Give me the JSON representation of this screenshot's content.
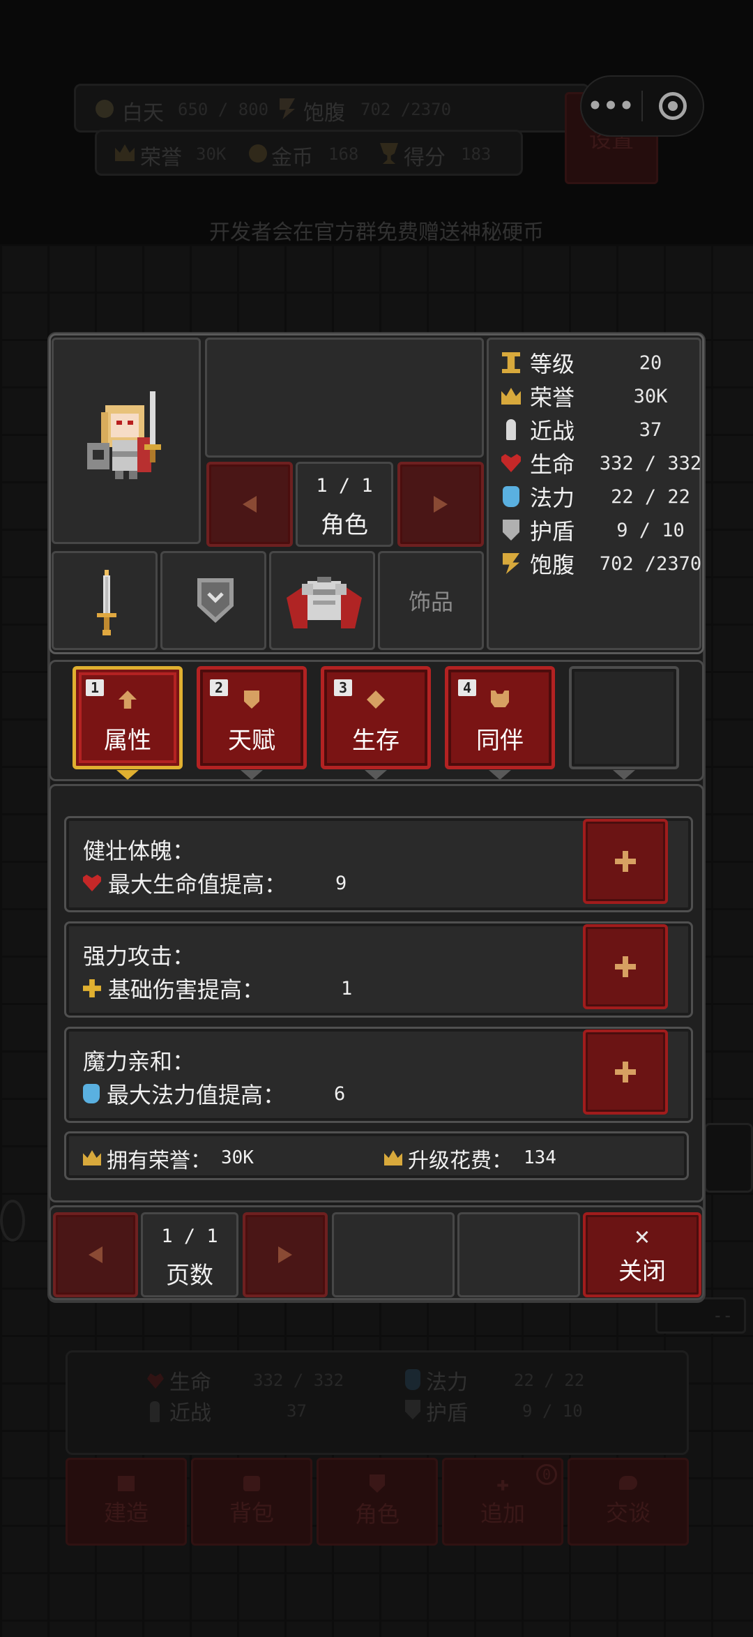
{
  "colors": {
    "accent_red": "#a11c1c",
    "tab_active_border": "#e0b030",
    "gold": "#d4a640",
    "background": "#141414"
  },
  "hud": {
    "day_label": "白天",
    "day_value": "650 / 800",
    "hunger_label": "饱腹",
    "hunger_value": "702 /2370",
    "honor_label": "荣誉",
    "honor_value": "30K",
    "gold_label": "金币",
    "gold_value": "168",
    "score_label": "得分",
    "score_value": "183",
    "settings_label": "设置",
    "notice": "开发者会在官方群免费赠送神秘硬币"
  },
  "capsule": {
    "more_icon": "more-dots-icon",
    "close_icon": "target-icon"
  },
  "character": {
    "page": "1 / 1",
    "tab_label": "角色",
    "slots": {
      "weapon_icon": "sword-icon",
      "shield_icon": "shield-icon",
      "armor_icon": "armor-icon",
      "accessory_label": "饰品"
    },
    "stats": [
      {
        "icon": "level-icon",
        "label": "等级",
        "value": "20"
      },
      {
        "icon": "crown-icon",
        "label": "荣誉",
        "value": "30K"
      },
      {
        "icon": "dagger-icon",
        "label": "近战",
        "value": "37"
      },
      {
        "icon": "heart-icon",
        "label": "生命",
        "value": "332 / 332"
      },
      {
        "icon": "potion-icon",
        "label": "法力",
        "value": "22 / 22"
      },
      {
        "icon": "shield-icon",
        "label": "护盾",
        "value": "9 / 10"
      },
      {
        "icon": "hunger-icon",
        "label": "饱腹",
        "value": "702 /2370"
      }
    ]
  },
  "tabs": [
    {
      "num": "1",
      "label": "属性",
      "icon": "arrow-up-icon",
      "active": true
    },
    {
      "num": "2",
      "label": "天赋",
      "icon": "shield-icon",
      "active": false
    },
    {
      "num": "3",
      "label": "生存",
      "icon": "diamond-icon",
      "active": false
    },
    {
      "num": "4",
      "label": "同伴",
      "icon": "paw-icon",
      "active": false
    }
  ],
  "skills": [
    {
      "title": "健壮体魄：",
      "icon": "heart-icon",
      "desc": "最大生命值提高：",
      "value": "9"
    },
    {
      "title": "强力攻击：",
      "icon": "sparkle-icon",
      "desc": "基础伤害提高：",
      "value": "1"
    },
    {
      "title": "魔力亲和：",
      "icon": "potion-icon",
      "desc": "最大法力值提高：",
      "value": "6"
    }
  ],
  "honor_bar": {
    "owned_label": "拥有荣誉：",
    "owned_value": "30K",
    "cost_label": "升级花费：",
    "cost_value": "134"
  },
  "pager": {
    "page": "1 / 1",
    "label": "页数",
    "close_label": "关闭"
  },
  "bottom_status": {
    "hp_label": "生命",
    "hp_value": "332 / 332",
    "mp_label": "法力",
    "mp_value": "22 / 22",
    "melee_label": "近战",
    "melee_value": "37",
    "shield_label": "护盾",
    "shield_value": "9 / 10"
  },
  "side_hint": "--",
  "actions": [
    {
      "label": "建造",
      "icon": "hammer-icon"
    },
    {
      "label": "背包",
      "icon": "bag-icon"
    },
    {
      "label": "角色",
      "icon": "shield-icon"
    },
    {
      "label": "追加",
      "icon": "plus-icon",
      "badge": "0"
    },
    {
      "label": "交谈",
      "icon": "chat-icon"
    }
  ]
}
